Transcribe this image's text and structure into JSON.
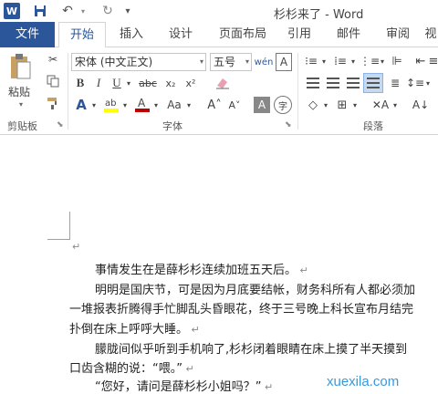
{
  "titlebar": {
    "app_logo": "W",
    "doc_title": "杉杉来了 - Word",
    "icons": [
      "word-logo-icon",
      "save-icon",
      "undo-icon",
      "redo-icon",
      "customize-qat-icon"
    ]
  },
  "tabs": [
    "文件",
    "开始",
    "插入",
    "设计",
    "页面布局",
    "引用",
    "邮件",
    "审阅",
    "视"
  ],
  "active_tab": "开始",
  "clipboard": {
    "paste_label": "粘贴",
    "group_label": "剪贴板"
  },
  "font": {
    "font_name": "宋体 (中文正文)",
    "font_size": "五号",
    "group_label": "字体",
    "highlight_color": "#ffff00",
    "font_color": "#c00000"
  },
  "paragraph": {
    "group_label": "段落"
  },
  "document": {
    "paragraphs": [
      "事情发生在是薛杉杉连续加班五天后。",
      "明明是国庆节，可是因为月底要结帐，财务科所有人都必须加",
      "一堆报表折腾得手忙脚乱头昏眼花，终于三号晚上科长宣布月结完",
      "扑倒在床上呼呼大睡。",
      "朦胧间似乎听到手机响了,杉杉闭着眼睛在床上摸了半天摸到",
      "口齿含糊的说：“喂。”",
      "“您好，请问是薛杉杉小姐吗？”"
    ]
  },
  "watermark": "xuexila.com"
}
